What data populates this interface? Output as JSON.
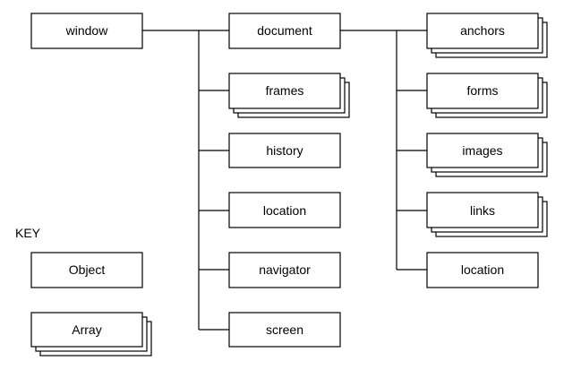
{
  "objects": {
    "window": {
      "label": "window",
      "kind": "object"
    },
    "document": {
      "label": "document",
      "kind": "object"
    },
    "frames": {
      "label": "frames",
      "kind": "array"
    },
    "history": {
      "label": "history",
      "kind": "object"
    },
    "location": {
      "label": "location",
      "kind": "object"
    },
    "navigator": {
      "label": "navigator",
      "kind": "object"
    },
    "screen": {
      "label": "screen",
      "kind": "object"
    },
    "anchors": {
      "label": "anchors",
      "kind": "array"
    },
    "forms": {
      "label": "forms",
      "kind": "array"
    },
    "images": {
      "label": "images",
      "kind": "array"
    },
    "links": {
      "label": "links",
      "kind": "array"
    },
    "doc_location": {
      "label": "location",
      "kind": "object"
    }
  },
  "key": {
    "title": "KEY",
    "object_label": "Object",
    "array_label": "Array"
  }
}
